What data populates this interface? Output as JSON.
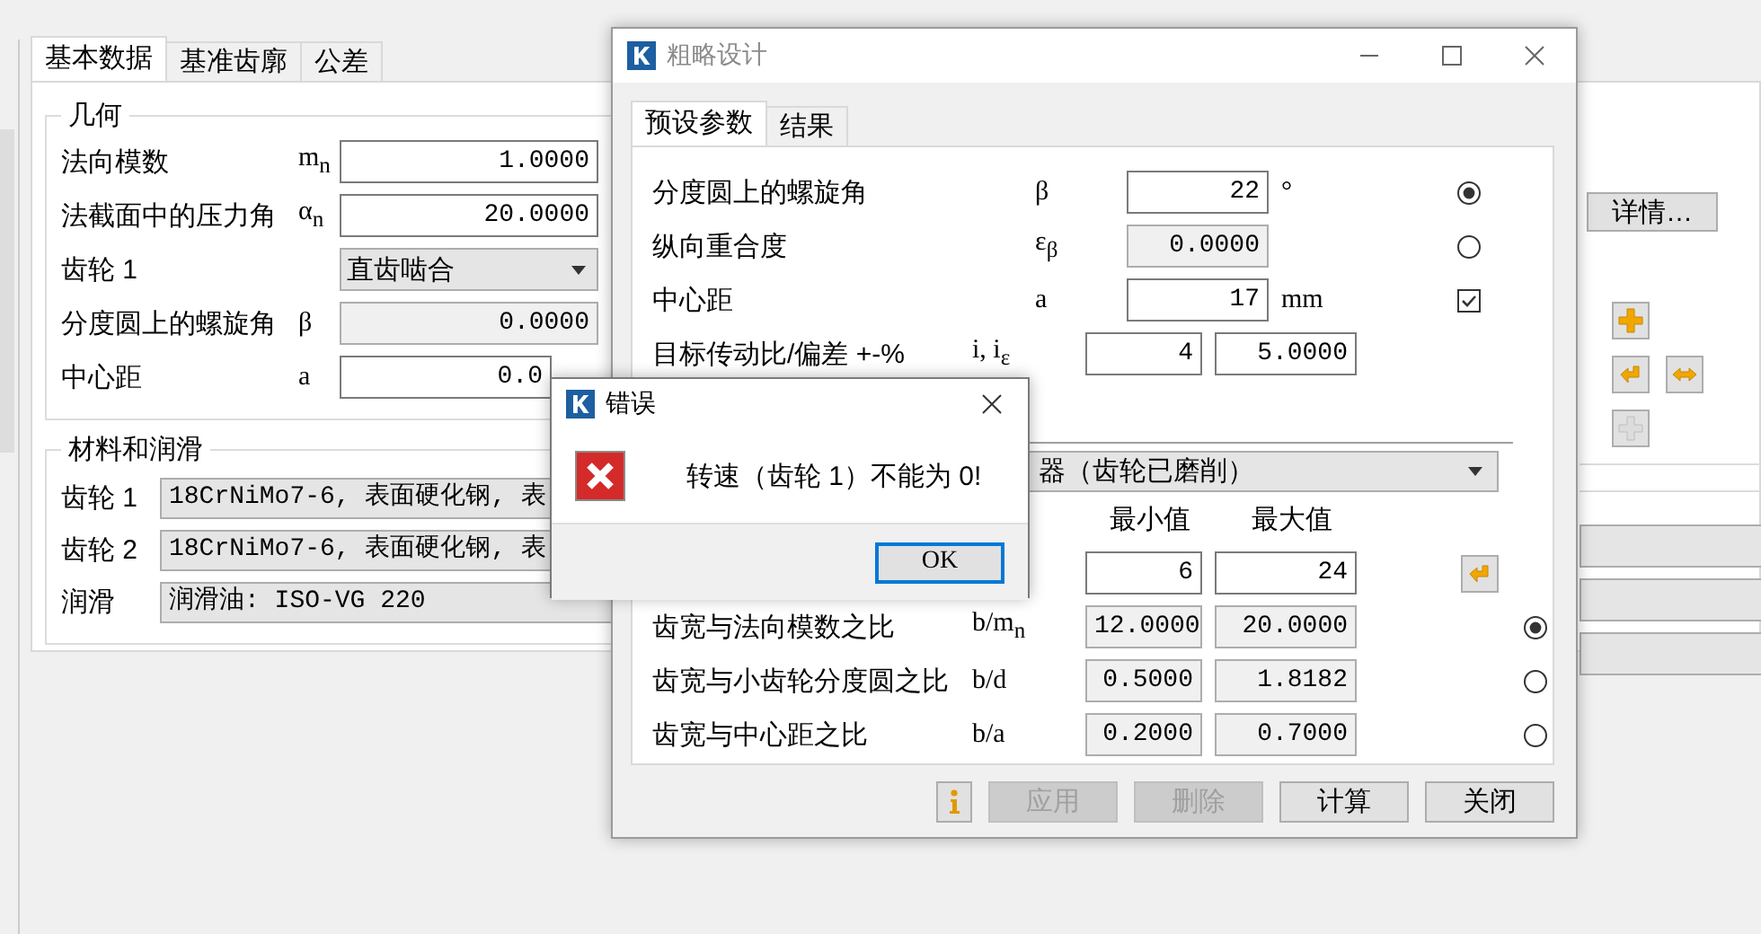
{
  "main": {
    "tabs": [
      {
        "label": "基本数据",
        "selected": true
      },
      {
        "label": "基准齿廓",
        "selected": false
      },
      {
        "label": "公差",
        "selected": false
      }
    ],
    "geometry": {
      "title": "几何",
      "rows": [
        {
          "label": "法向模数",
          "symbol": "m$_{n}$",
          "kind": "input",
          "value": "1.0000"
        },
        {
          "label": "法截面中的压力角",
          "symbol": "α$_{n}$",
          "kind": "input",
          "value": "20.0000"
        },
        {
          "label": "齿轮 1",
          "kind": "select",
          "value": "直齿啮合"
        },
        {
          "label": "分度圆上的螺旋角",
          "symbol": "β",
          "kind": "readonly",
          "value": "0.0000"
        },
        {
          "label": "中心距",
          "symbol": "a",
          "kind": "input",
          "value": "0.0"
        }
      ]
    },
    "details_button": "详情…",
    "materials": {
      "title": "材料和润滑",
      "rows": [
        {
          "label": "齿轮 1",
          "value": "18CrNiMo7-6, 表面硬化钢, 表"
        },
        {
          "label": "齿轮 2",
          "value": "18CrNiMo7-6, 表面硬化钢, 表"
        },
        {
          "label": "润滑",
          "value": "润滑油: ISO-VG 220"
        }
      ]
    }
  },
  "dialog": {
    "title": "粗略设计",
    "tabs": [
      {
        "label": "预设参数",
        "selected": true
      },
      {
        "label": "结果",
        "selected": false
      }
    ],
    "rows": [
      {
        "kind": "single",
        "label": "分度圆上的螺旋角",
        "symbol": "β",
        "value": "22",
        "readonly": false,
        "unit": "°",
        "control": {
          "kind": "radio",
          "selected": true
        }
      },
      {
        "kind": "single",
        "label": "纵向重合度",
        "symbol": "ε$_{β}$",
        "value": "0.0000",
        "readonly": true,
        "control": {
          "kind": "radio",
          "selected": false
        }
      },
      {
        "kind": "single",
        "label": "中心距",
        "symbol": "a",
        "value": "17",
        "readonly": false,
        "unit": "mm",
        "control": {
          "kind": "checkbox",
          "checked": true
        }
      },
      {
        "kind": "pair",
        "label": "目标传动比/偏差 +-%",
        "symbol": "i, i$_{ε}$",
        "values": [
          "4",
          "5.0000"
        ]
      }
    ],
    "dropdown": "器（齿轮已磨削）",
    "range_headers": [
      "最小值",
      "最大值"
    ],
    "ranges": [
      {
        "min": "6",
        "max": "24",
        "readonly": false,
        "control": {
          "kind": "button"
        }
      },
      {
        "label": "齿宽与法向模数之比",
        "symbol": "b/m$_{n}$",
        "min": "12.0000",
        "max": "20.0000",
        "readonly": true,
        "control": {
          "kind": "radio",
          "selected": true
        }
      },
      {
        "label": "齿宽与小齿轮分度圆之比",
        "symbol": "b/d",
        "min": "0.5000",
        "max": "1.8182",
        "readonly": true,
        "control": {
          "kind": "radio",
          "selected": false
        }
      },
      {
        "label": "齿宽与中心距之比",
        "symbol": "b/a",
        "min": "0.2000",
        "max": "0.7000",
        "readonly": true,
        "control": {
          "kind": "radio",
          "selected": false
        }
      }
    ],
    "buttons": [
      {
        "label": "应用",
        "disabled": true
      },
      {
        "label": "删除",
        "disabled": true
      },
      {
        "label": "计算",
        "disabled": false
      },
      {
        "label": "关闭",
        "disabled": false
      }
    ]
  },
  "error": {
    "title": "错误",
    "message": "转速（齿轮 1）不能为 0!",
    "button": "OK"
  }
}
